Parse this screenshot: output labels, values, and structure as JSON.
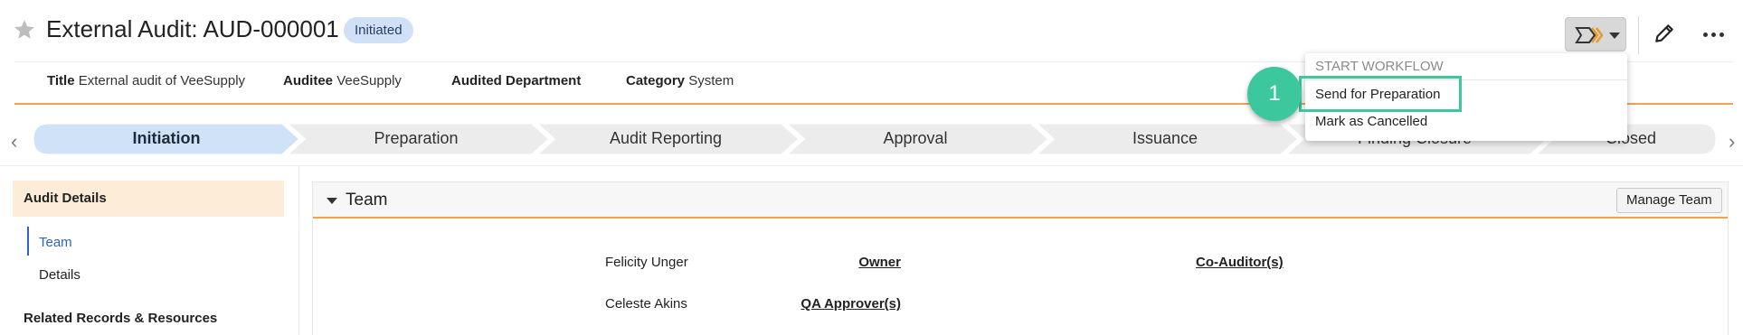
{
  "header": {
    "title": "External Audit: AUD-000001",
    "status_badge": "Initiated"
  },
  "attributes": [
    {
      "label": "Title",
      "value": "External audit of VeeSupply"
    },
    {
      "label": "Auditee",
      "value": "VeeSupply"
    },
    {
      "label": "Audited Department",
      "value": ""
    },
    {
      "label": "Category",
      "value": "System"
    }
  ],
  "stages": [
    {
      "label": "Initiation",
      "active": true
    },
    {
      "label": "Preparation",
      "active": false
    },
    {
      "label": "Audit Reporting",
      "active": false
    },
    {
      "label": "Approval",
      "active": false
    },
    {
      "label": "Issuance",
      "active": false
    },
    {
      "label": "Finding Closure",
      "active": false
    },
    {
      "label": "Closed",
      "active": false
    }
  ],
  "stage_nav": {
    "prev": "‹",
    "next": "›"
  },
  "left_nav": {
    "section_title": "Audit Details",
    "items": [
      "Team",
      "Details"
    ],
    "selected": "Team",
    "related_title": "Related Records & Resources"
  },
  "team_panel": {
    "title": "Team",
    "manage_button": "Manage Team",
    "fields": [
      {
        "label": "Owner",
        "value": "Felicity Unger"
      },
      {
        "label": "Co-Auditor(s)",
        "value": ""
      },
      {
        "label": "QA Approver(s)",
        "value": "Celeste Akins"
      }
    ]
  },
  "workflow_menu": {
    "header": "START WORKFLOW",
    "items": [
      "Send for Preparation",
      "Mark as Cancelled"
    ]
  },
  "step_marker": {
    "number": "1"
  },
  "colors": {
    "accent_orange": "#f0a24c",
    "active_stage": "#cfe2f8",
    "highlight_green": "#3cc89c",
    "link_blue": "#2a63c9"
  },
  "icons": [
    "star-icon",
    "workflow-icon",
    "chevron-down-icon",
    "pencil-icon",
    "more-icon",
    "triangle-down-icon"
  ]
}
